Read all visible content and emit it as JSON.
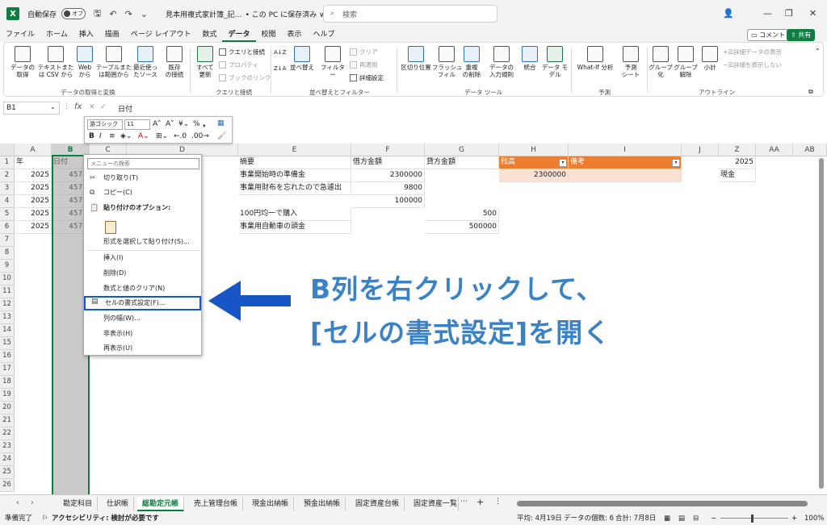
{
  "titlebar": {
    "autosave": "自動保存",
    "autosave_state": "オフ",
    "doc_title": "見本用複式家計簿_記…",
    "save_location": "• この PC に保存済み ∨",
    "search_placeholder": "検索"
  },
  "menu": {
    "tabs": [
      "ファイル",
      "ホーム",
      "挿入",
      "描画",
      "ページ レイアウト",
      "数式",
      "データ",
      "校閲",
      "表示",
      "ヘルプ"
    ],
    "active": "データ",
    "comment": "コメント",
    "share": "共有"
  },
  "ribbon": {
    "get_data": "データの\n取得",
    "text_csv": "テキストまた\nは CSV から",
    "web": "Web\nから",
    "table_range": "テーブルまた\nは範囲から",
    "recent": "最近使っ\nたソース",
    "existing": "既存\nの接続",
    "group1": "データの取得と変換",
    "refresh_all": "すべて\n更新",
    "queries": "クエリと接続",
    "properties": "プロパティ",
    "workbook_links": "ブックのリンク",
    "group2": "クエリと接続",
    "sort_az": "A↓Z",
    "sort": "並べ替え",
    "filter": "フィルター",
    "clear": "クリア",
    "reapply": "再適用",
    "advanced": "詳細設定",
    "group3": "並べ替えとフィルター",
    "text_to_cols": "区切り位置",
    "flash_fill": "フラッシュ\nフィル",
    "remove_dup": "重複\nの削除",
    "validation": "データの\n入力規則",
    "consolidate": "統合",
    "data_model": "データ モ\nデル",
    "group4": "データ ツール",
    "whatif": "What-If 分析",
    "forecast": "予測\nシート",
    "group5": "予測",
    "group_btn": "グループ\n化",
    "ungroup": "グループ\n解除",
    "subtotal": "小計",
    "show_detail": "詳細データの表示",
    "hide_detail": "詳細を表示しない",
    "group6": "アウトライン"
  },
  "formula_bar": {
    "name_box": "B1",
    "fx": "fx",
    "content": "日付"
  },
  "mini_toolbar": {
    "font": "游ゴシック",
    "size": "11"
  },
  "columns": [
    "A",
    "B",
    "C",
    "D",
    "E",
    "F",
    "G",
    "H",
    "I",
    "J",
    "Z",
    "AA",
    "AB"
  ],
  "rows": [
    "1",
    "2",
    "3",
    "4",
    "5",
    "6",
    "7",
    "8",
    "9",
    "10",
    "11",
    "12",
    "13",
    "14",
    "15",
    "16",
    "17",
    "18",
    "19",
    "20",
    "21",
    "22",
    "23",
    "24",
    "25",
    "26"
  ],
  "cells": {
    "a1": "年",
    "b1": "日付",
    "e1": "摘要",
    "f1": "借方金額",
    "g1": "貸方金額",
    "h1": "残高",
    "i1": "備考",
    "z1": "2025",
    "a2": "2025",
    "b2": "4574",
    "e2": "事業開始時の準備金",
    "f2": "2300000",
    "h2": "2300000",
    "z2": "現金",
    "a3": "2025",
    "b3": "4576",
    "e3": "事業用財布を忘れたので急遽出",
    "f3": "9800",
    "a4": "2025",
    "b4": "4576",
    "f4": "100000",
    "a5": "2025",
    "b5": "4577",
    "e5": "100円均一で購入",
    "g5": "500",
    "a6": "2025",
    "b6": "4577",
    "e6": "事業用自動車の頭金",
    "g6": "500000"
  },
  "context_menu": {
    "search": "メニューの検索",
    "cut": "切り取り(T)",
    "copy": "コピー(C)",
    "paste_options": "貼り付けのオプション:",
    "paste_special": "形式を選択して貼り付け(S)...",
    "insert": "挿入(I)",
    "delete": "削除(D)",
    "clear": "数式と値のクリア(N)",
    "format_cells": "セルの書式設定(F)...",
    "col_width": "列の幅(W)...",
    "hide": "非表示(H)",
    "unhide": "再表示(U)"
  },
  "annotation": {
    "line1": "B列を右クリックして、",
    "line2": "[セルの書式設定]を開く"
  },
  "sheets": [
    "勘定科目",
    "仕訳帳",
    "総勘定元帳",
    "売上管理台帳",
    "現金出納帳",
    "預金出納帳",
    "固定資産台帳",
    "固定資産一覧"
  ],
  "active_sheet": "総勘定元帳",
  "status": {
    "ready": "準備完了",
    "accessibility": "アクセシビリティ: 検討が必要です",
    "average": "平均: 4月19日",
    "count": "データの個数: 6",
    "sum": "合計: 7月8日",
    "zoom": "100%"
  },
  "colors": {
    "excel_green": "#107c41",
    "orange": "#ed7d31",
    "annotation_blue": "#3b82c4",
    "arrow_blue": "#1856c8"
  }
}
